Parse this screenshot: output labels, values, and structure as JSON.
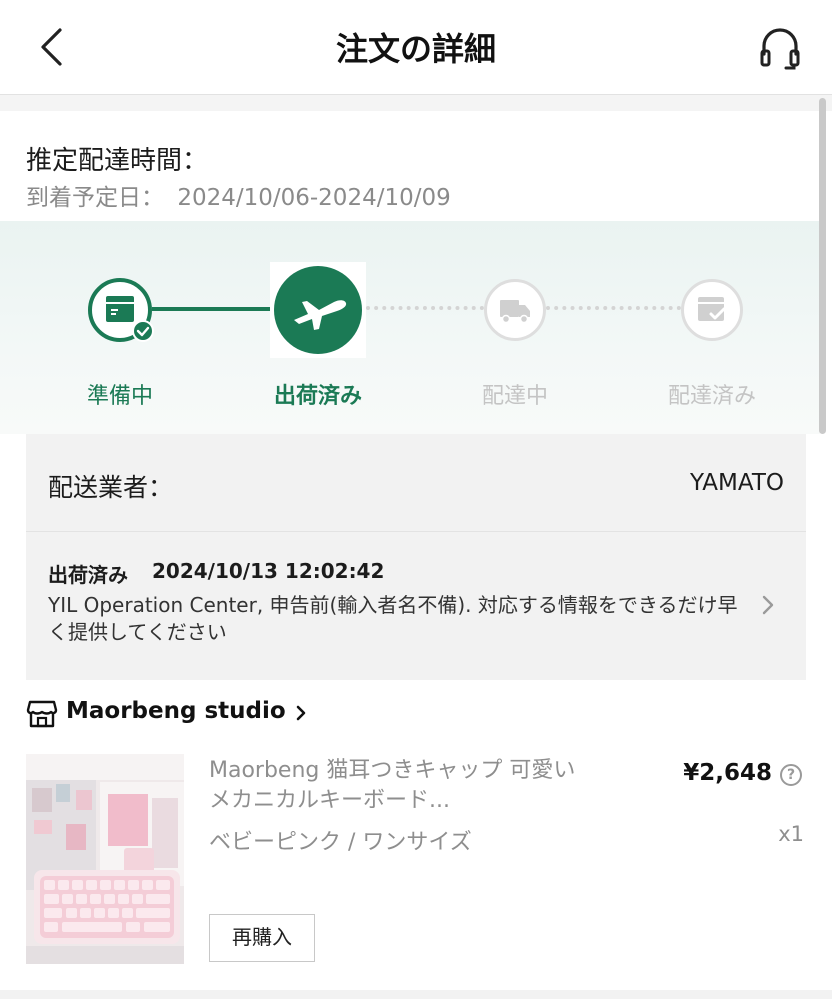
{
  "header": {
    "title": "注文の詳細",
    "back_icon": "chevron-left-icon",
    "support_icon": "headset-icon"
  },
  "delivery_estimate": {
    "title": "推定配達時間：",
    "date_label": "到着予定日：",
    "date_range": "2024/10/06-2024/10/09"
  },
  "tracker": {
    "current_step": 2,
    "steps": [
      {
        "label": "準備中",
        "icon": "package-icon",
        "state": "done"
      },
      {
        "label": "出荷済み",
        "icon": "airplane-icon",
        "state": "current"
      },
      {
        "label": "配達中",
        "icon": "truck-icon",
        "state": "pending"
      },
      {
        "label": "配達済み",
        "icon": "delivered-box-icon",
        "state": "pending"
      }
    ]
  },
  "carrier": {
    "label": "配送業者：",
    "name": "YAMATO"
  },
  "latest_event": {
    "status": "出荷済み",
    "timestamp": "2024/10/13 12:02:42",
    "description": "YIL Operation Center, 申告前(輸入者名不備). 対応する情報をできるだけ早く提供してください"
  },
  "store": {
    "name": "Maorbeng studio",
    "icon": "store-icon"
  },
  "product": {
    "title": "Maorbeng 猫耳つきキャップ 可愛い　メカニカルキーボード...",
    "variant": "ベビーピンク / ワンサイズ",
    "price": "¥2,648",
    "help_icon": "question-circle-icon",
    "help_glyph": "?",
    "quantity": "x1",
    "rebuy_label": "再購入"
  },
  "colors": {
    "accent": "#1b7a55",
    "inactive": "#c4c4c4",
    "muted_text": "#8e8e8e"
  }
}
